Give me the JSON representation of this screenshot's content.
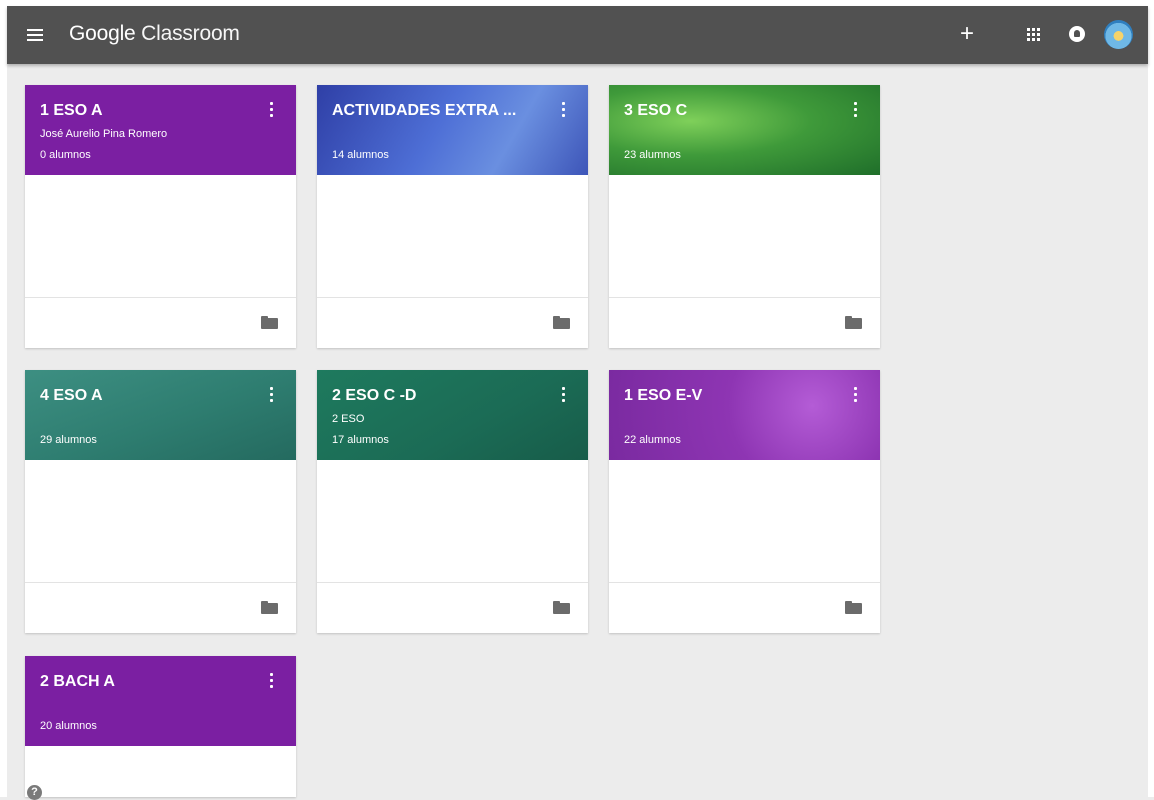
{
  "app": {
    "brand_google": "Google",
    "brand_product": "Classroom"
  },
  "icons": {
    "menu": "menu-icon",
    "create": "plus-icon",
    "apps": "apps-grid-icon",
    "notifications": "notification-icon",
    "avatar": "avatar",
    "card_more": "more-vert-icon",
    "folder": "folder-icon",
    "help": "help-icon"
  },
  "header": {
    "plus_label": "+"
  },
  "colors": {
    "topbar": "#515151",
    "background": "#ececec",
    "purple": "#7b1fa2",
    "blue": "#3f5bb8",
    "green": "#3f9a3a",
    "teal": "#2e7d70",
    "dark_green": "#1b6b55",
    "violet": "#8e35b3"
  },
  "classes": [
    {
      "title": "1 ESO A",
      "subtitle": "José Aurelio Pina Romero",
      "students": "0 alumnos"
    },
    {
      "title": "ACTIVIDADES EXTRA ...",
      "subtitle": "",
      "students": "14 alumnos"
    },
    {
      "title": "3 ESO C",
      "subtitle": "",
      "students": "23 alumnos"
    },
    {
      "title": "4 ESO A",
      "subtitle": "",
      "students": "29 alumnos"
    },
    {
      "title": "2 ESO C -D",
      "subtitle": "2 ESO",
      "students": "17 alumnos"
    },
    {
      "title": "1 ESO E-V",
      "subtitle": "",
      "students": "22 alumnos"
    },
    {
      "title": "2 BACH A",
      "subtitle": "",
      "students": "20 alumnos"
    }
  ],
  "help": {
    "glyph": "?"
  }
}
